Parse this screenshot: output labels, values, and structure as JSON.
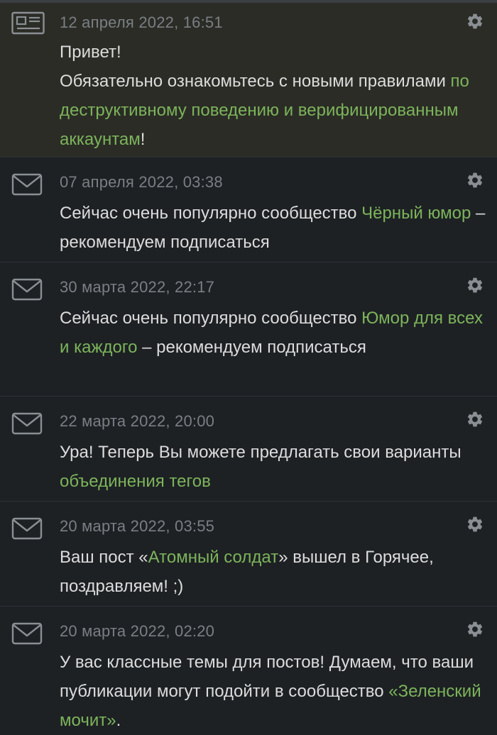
{
  "accent_color": "#7cb45b",
  "notifications": [
    {
      "type": "news",
      "icon": "newspaper-icon",
      "date": "12 апреля 2022, 16:51",
      "line1": "Привет!",
      "line2": "Обязательно ознакомьтесь с новыми правилами ",
      "link1": "по деструктивному поведению и верифицированным аккаунтам",
      "tail": "!"
    },
    {
      "type": "message",
      "icon": "envelope-icon",
      "date": "07 апреля 2022, 03:38",
      "text_before": "Сейчас очень популярно сообщество ",
      "link": "Чёрный юмор",
      "text_after": " – рекомендуем подписаться"
    },
    {
      "type": "message",
      "icon": "envelope-icon",
      "date": "30 марта 2022, 22:17",
      "text_before": "Сейчас очень популярно сообщество ",
      "link": "Юмор для всех и каждого",
      "text_after": " – рекомендуем подписаться"
    },
    {
      "type": "message",
      "icon": "envelope-icon",
      "date": "22 марта 2022, 20:00",
      "text_before": "Ура! Теперь Вы можете предлагать свои варианты ",
      "link": "объединения тегов",
      "text_after": ""
    },
    {
      "type": "message",
      "icon": "envelope-icon",
      "date": "20 марта 2022, 03:55",
      "text_before": "Ваш пост «",
      "link": "Атомный солдат",
      "text_after": "» вышел в Горячее, поздравляем! ;)"
    },
    {
      "type": "message",
      "icon": "envelope-icon",
      "date": "20 марта 2022, 02:20",
      "text_before": "У вас классные темы для постов! Думаем, что ваши публикации могут подойти в сообщество ",
      "link": "«Зеленский мочит»",
      "text_after": "."
    }
  ]
}
